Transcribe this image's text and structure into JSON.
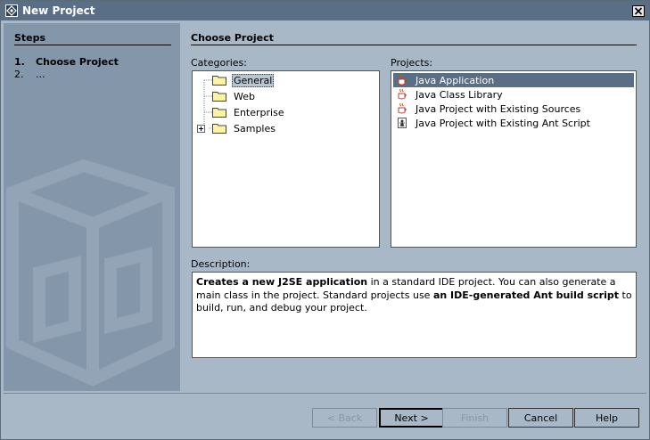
{
  "window": {
    "title": "New Project"
  },
  "steps": {
    "header": "Steps",
    "items": [
      {
        "num": "1.",
        "label": "Choose Project",
        "current": true
      },
      {
        "num": "2.",
        "label": "...",
        "current": false
      }
    ]
  },
  "main": {
    "title": "Choose Project",
    "categories_label": "Categories:",
    "projects_label": "Projects:",
    "description_label": "Description:",
    "categories": [
      {
        "label": "General",
        "selected": true,
        "expandable": false
      },
      {
        "label": "Web",
        "selected": false,
        "expandable": false
      },
      {
        "label": "Enterprise",
        "selected": false,
        "expandable": false
      },
      {
        "label": "Samples",
        "selected": false,
        "expandable": true
      }
    ],
    "projects": [
      {
        "label": "Java Application",
        "icon": "java-cup-icon",
        "selected": true
      },
      {
        "label": "Java Class Library",
        "icon": "java-cup-icon",
        "selected": false
      },
      {
        "label": "Java Project with Existing Sources",
        "icon": "java-cup-icon",
        "selected": false
      },
      {
        "label": "Java Project with Existing Ant Script",
        "icon": "ant-script-icon",
        "selected": false
      }
    ],
    "description": {
      "part1_bold": "Creates a new J2SE application",
      "part2": " in a standard IDE project. You can also generate a main class in the project. Standard projects use ",
      "part3_bold": "an IDE-generated Ant build script",
      "part4": " to build, run, and debug your project."
    }
  },
  "buttons": {
    "back": "< Back",
    "next": "Next >",
    "finish": "Finish",
    "cancel": "Cancel",
    "help": "Help"
  },
  "colors": {
    "titlebar": "#5a6f86",
    "dialog_bg": "#a9b8c6",
    "steps_bg": "#8396aa",
    "selection": "#5a6f86"
  }
}
